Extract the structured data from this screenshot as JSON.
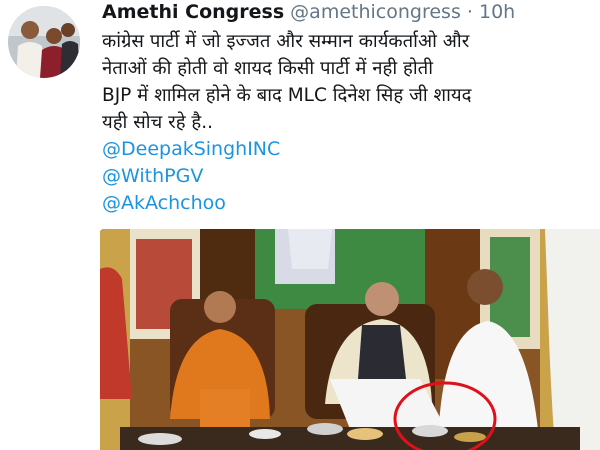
{
  "tweet": {
    "display_name": "Amethi Congress",
    "handle": "@amethicongress",
    "separator": "·",
    "timestamp": "10h",
    "text_lines": [
      "कांग्रेस पार्टी में जो इज्जत और सम्मान कार्यकर्ताओ और",
      "नेताओं की होती वो शायद किसी पार्टी में नही होती",
      "BJP में शामिल होने के बाद  MLC दिनेश सिह जी शायद",
      "यही सोच रहे है.."
    ],
    "mentions": [
      "@DeepakSinghINC",
      "@WithPGV",
      "@AkAchchoo"
    ]
  },
  "colors": {
    "link": "#1b95e0",
    "secondary_text": "#657786",
    "annotation_circle": "#e0101a"
  }
}
